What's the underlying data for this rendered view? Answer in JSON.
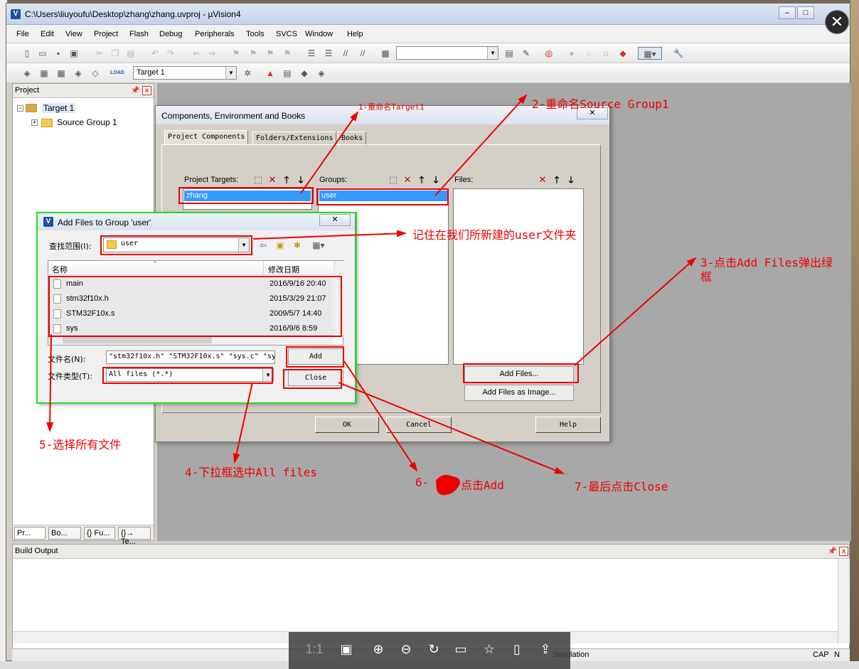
{
  "window": {
    "title": "C:\\Users\\liuyoufu\\Desktop\\zhang\\zhang.uvproj - µVision4",
    "app_icon": "uvision-icon"
  },
  "menu": [
    "File",
    "Edit",
    "View",
    "Project",
    "Flash",
    "Debug",
    "Peripherals",
    "Tools",
    "SVCS",
    "Window",
    "Help"
  ],
  "toolbar2": {
    "load_label": "LOAD",
    "target_value": "Target 1"
  },
  "project_panel": {
    "title": "Project",
    "tree": {
      "target": "Target 1",
      "group": "Source Group 1"
    },
    "tabs": [
      "Pr...",
      "Bo...",
      "{} Fu...",
      "{}→ Te..."
    ]
  },
  "build_output": {
    "title": "Build Output"
  },
  "status": {
    "mode": "Simulation",
    "caps": "CAP",
    "num": "N"
  },
  "ceb_dialog": {
    "title": "Components, Environment and Books",
    "tabs": [
      "Project Components",
      "Folders/Extensions",
      "Books"
    ],
    "targets_label": "Project Targets:",
    "target_item": "zhang",
    "groups_label": "Groups:",
    "group_item": "user",
    "files_label": "Files:",
    "add_files": "Add Files...",
    "add_files_image": "Add Files as Image...",
    "ok": "OK",
    "cancel": "Cancel",
    "help": "Help"
  },
  "add_dialog": {
    "title": "Add Files to Group 'user'",
    "look_in_label": "查找范围(I):",
    "look_in_value": "user",
    "col_name": "名称",
    "col_date": "修改日期",
    "files": [
      {
        "name": "main",
        "date": "2016/9/16 20:40"
      },
      {
        "name": "stm32f10x.h",
        "date": "2015/3/29 21:07"
      },
      {
        "name": "STM32F10x.s",
        "date": "2009/5/7 14:40"
      },
      {
        "name": "sys",
        "date": "2016/9/6 8:59"
      }
    ],
    "filename_label": "文件名(N):",
    "filename_value": "\"stm32f10x.h\" \"STM32F10x.s\" \"sys.c\" \"sy",
    "filetype_label": "文件类型(T):",
    "filetype_value": "All files (*.*)",
    "add_btn": "Add",
    "close_btn": "Close"
  },
  "annotations": {
    "n1": "1-重命名Target1",
    "n2": "2-重命名Source Group1",
    "n3a": "3-点击Add Files弹出绿",
    "n3b": "框",
    "n_user": "记住在我们所新建的user文件夹",
    "n4": "4-下拉框选中All files",
    "n5": "5-选择所有文件",
    "n6a": "6-",
    "n6b": "点击Add",
    "n7": "7-最后点击Close"
  },
  "viewer": {
    "ratio": "1:1"
  },
  "colors": {
    "annotation": "#e00000",
    "highlight": "#22dd22",
    "selection": "#3399ff"
  }
}
